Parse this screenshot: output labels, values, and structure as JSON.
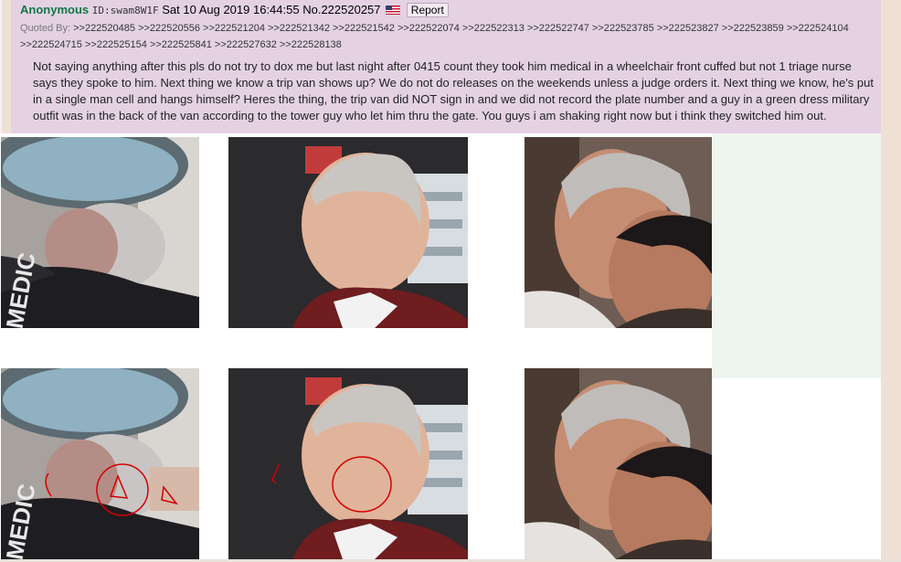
{
  "post": {
    "name": "Anonymous",
    "id_label": "ID:",
    "id_value": "swam8W1F",
    "date": "Sat 10 Aug 2019 16:44:55",
    "number": "No.222520257",
    "report_label": "Report",
    "quoted_label": "Quoted By:",
    "quoted_refs": [
      ">>222520485",
      ">>222520556",
      ">>222521204",
      ">>222521342",
      ">>222521542",
      ">>222522074",
      ">>222522313",
      ">>222522747",
      ">>222523785",
      ">>222523827",
      ">>222523859",
      ">>222524104",
      ">>222524715",
      ">>222525154",
      ">>222525841",
      ">>222527632",
      ">>222528138"
    ],
    "message": "Not saying anything after this pls do not try to dox me but last night after 0415 count they took him medical in a wheelchair front cuffed but not 1 triage nurse says they spoke to him. Next thing we know a trip van shows up? We do not do releases on the weekends unless a judge orders it. Next thing we know, he's put in a single man cell and hangs himself? Heres the thing, the trip van did NOT sign in and we did not record the plate number and a guy in a green dress military outfit was in the back of the van according to the tower guy who let him thru the gate. You guys i am shaking right now but i think they switched him out."
  },
  "images": [
    {
      "icon": "photo-man-in-car-profile"
    },
    {
      "icon": "photo-man-grey-hair-profile"
    },
    {
      "icon": "photo-two-men-courtroom"
    },
    {
      "icon": "photo-man-in-car-profile-annotated"
    },
    {
      "icon": "photo-man-grey-hair-profile-annotated"
    },
    {
      "icon": "photo-two-men-courtroom-copy"
    }
  ],
  "colors": {
    "post_bg": "#e4d2e4",
    "name": "#117743",
    "page_bg": "#efe0d6",
    "annotation_red": "#d40000"
  }
}
